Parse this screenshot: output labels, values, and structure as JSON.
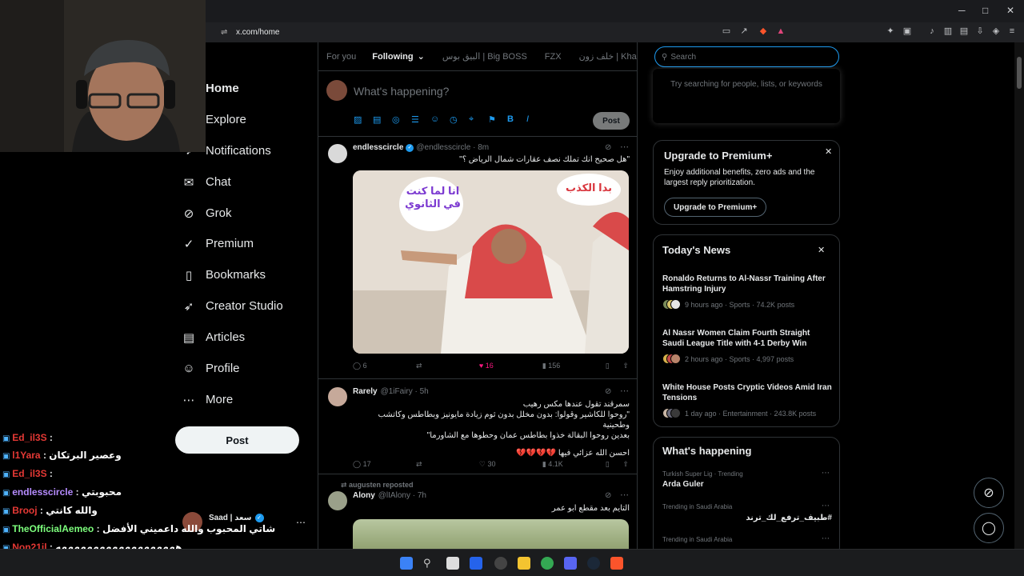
{
  "browser": {
    "url": "x.com/home",
    "window_controls": [
      "─",
      "□",
      "✕"
    ]
  },
  "nav": {
    "items": [
      {
        "label": "Home",
        "icon": "home-icon"
      },
      {
        "label": "Explore",
        "icon": "search-icon"
      },
      {
        "label": "Notifications",
        "icon": "bell-icon"
      },
      {
        "label": "Chat",
        "icon": "mail-icon"
      },
      {
        "label": "Grok",
        "icon": "grok-icon"
      },
      {
        "label": "Premium",
        "icon": "verified-icon"
      },
      {
        "label": "Bookmarks",
        "icon": "bookmark-icon"
      },
      {
        "label": "Creator Studio",
        "icon": "rocket-icon"
      },
      {
        "label": "Articles",
        "icon": "article-icon"
      },
      {
        "label": "Profile",
        "icon": "person-icon"
      },
      {
        "label": "More",
        "icon": "more-icon"
      }
    ],
    "post_label": "Post",
    "account_name": "Saad | سعد"
  },
  "feed": {
    "tabs": [
      "For you",
      "Following",
      "البيق بوس | Big BOSS",
      "FZX",
      "خلف زون | KhalafZone"
    ],
    "compose_placeholder": "What's happening?",
    "compose_post_label": "Post",
    "tweets": [
      {
        "name": "endlesscircle",
        "handle": "@endlesscircle · 8m",
        "text": "\"هل صحيح انك تملك نصف عقارات شمال الرياض ؟\"",
        "image_text_left": "انا لما كنت في الثانوي",
        "image_text_right": "بدا الكذب",
        "replies": "6",
        "likes": "16",
        "views": "156"
      },
      {
        "name": "Rarely",
        "handle": "@1iFairy · 5h",
        "text_lines": [
          "سمرقند تقول عندها مكس رهيب",
          "\"روحوا للكاشير وقولوا: بدون مخلل بدون ثوم زيادة مايونيز وبطاطس وكاتشب وطحينية",
          "بعدين روحوا البقالة خذوا بطاطس عمان وحطوها مع الشاورما\"",
          "احسن الله عزائي فيها 💔💔💔💔"
        ],
        "replies": "17",
        "likes": "30",
        "views": "4.1K"
      },
      {
        "reposted_by": "augusten reposted",
        "name": "Alony",
        "handle": "@lIAlony · 7h",
        "text": "التايم بعد مقطع ابو عمر"
      }
    ]
  },
  "sidebar": {
    "search_placeholder": "Search",
    "search_hint": "Try searching for people, lists, or keywords",
    "premium": {
      "title": "Upgrade to Premium+",
      "body": "Enjoy additional benefits, zero ads and the largest reply prioritization.",
      "button": "Upgrade to Premium+"
    },
    "news": {
      "title": "Today's News",
      "items": [
        {
          "headline": "Ronaldo Returns to Al-Nassr Training After Hamstring Injury",
          "meta": "9 hours ago · Sports · 74.2K posts"
        },
        {
          "headline": "Al Nassr Women Claim Fourth Straight Saudi League Title with 4-1 Derby Win",
          "meta": "2 hours ago · Sports · 4,997 posts"
        },
        {
          "headline": "White House Posts Cryptic Videos Amid Iran Tensions",
          "meta": "1 day ago · Entertainment · 243.8K posts"
        }
      ]
    },
    "happening": {
      "title": "What's happening",
      "items": [
        {
          "context": "Turkish Super Lig · Trending",
          "topic": "Arda Guler"
        },
        {
          "context": "Trending in Saudi Arabia",
          "topic": "#طبيف_ترفع_لك_ترند"
        },
        {
          "context": "Trending in Saudi Arabia",
          "topic": ""
        }
      ]
    }
  },
  "stream_chat": [
    {
      "user": "Ed_il3S",
      "msg": "",
      "color": "#e53935"
    },
    {
      "user": "l1Yara",
      "msg": "وعصير البرتكان",
      "color": "#e53935"
    },
    {
      "user": "Ed_il3S",
      "msg": "",
      "color": "#e53935"
    },
    {
      "user": "endlesscircle",
      "msg": "محبوبتي",
      "color": "#b68cff"
    },
    {
      "user": "Brooj",
      "msg": "والله كانتي",
      "color": "#e53935"
    },
    {
      "user": "TheOfficialAemeo",
      "msg": "شاتي المحبوب والله داعميني الأفضل",
      "color": "#7dff7d"
    },
    {
      "user": "Non21jl",
      "msg": "هههههههههههههههههههه",
      "color": "#e53935"
    }
  ],
  "colors": {
    "accent": "#1d9bf0",
    "like": "#f91880",
    "bg": "#000000",
    "border": "#2f3336"
  }
}
